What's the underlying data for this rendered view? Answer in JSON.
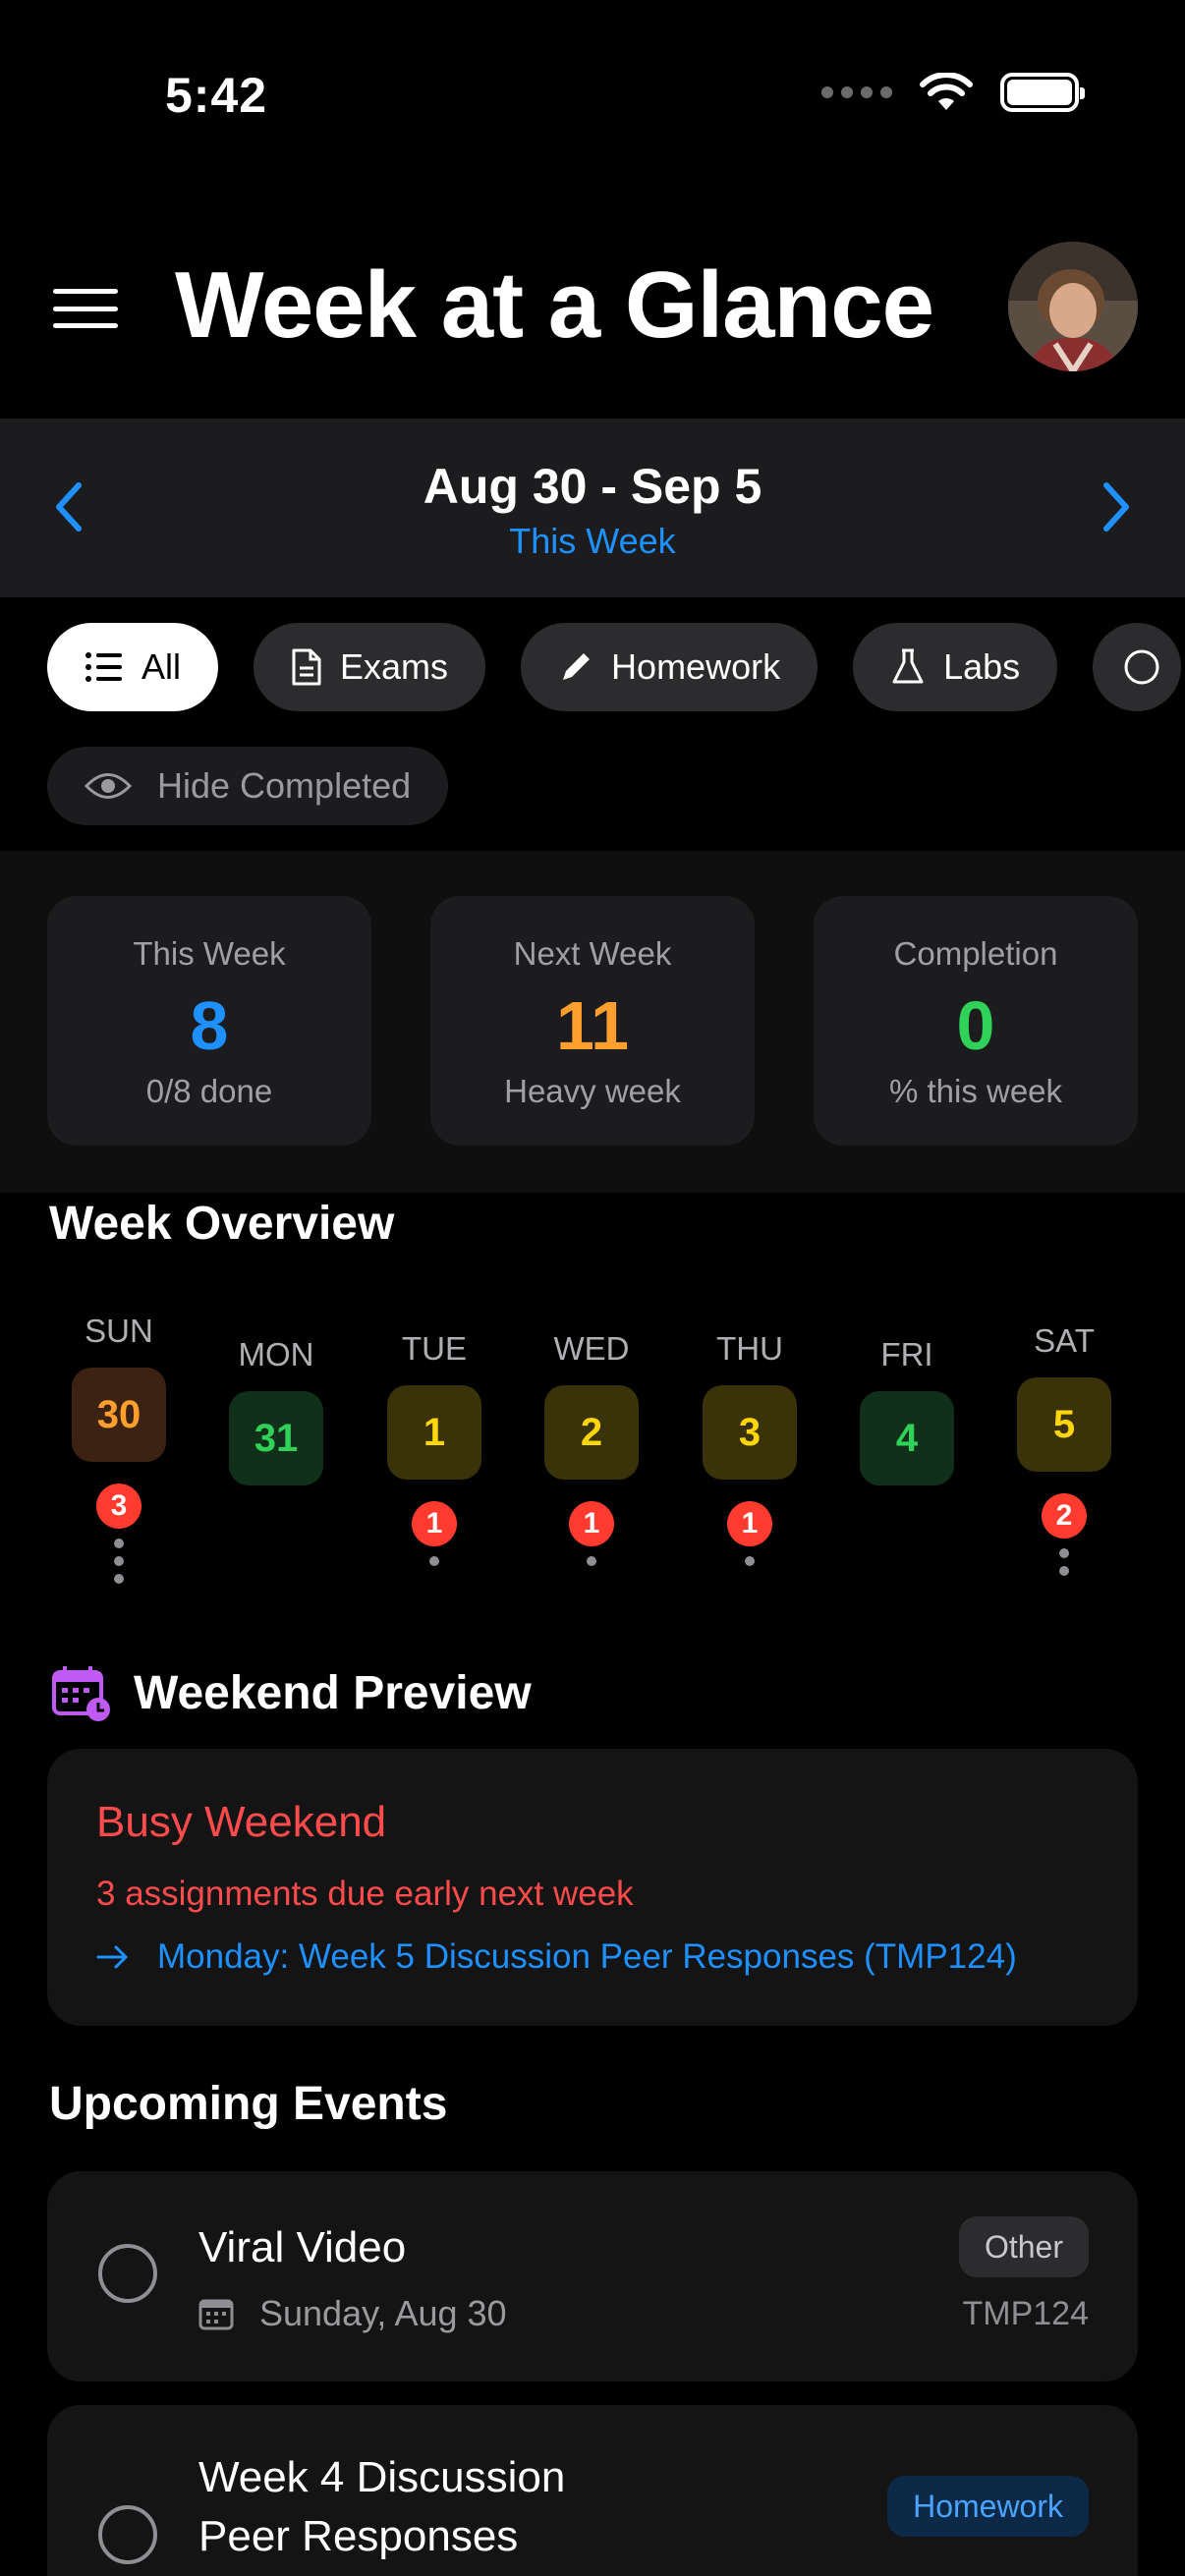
{
  "status_bar": {
    "time": "5:42"
  },
  "header": {
    "title": "Week at a Glance"
  },
  "week_nav": {
    "range": "Aug 30 - Sep 5",
    "sub": "This Week"
  },
  "filters": {
    "chips": [
      {
        "label": "All",
        "icon": "list-icon",
        "active": true
      },
      {
        "label": "Exams",
        "icon": "document-icon"
      },
      {
        "label": "Homework",
        "icon": "pencil-icon"
      },
      {
        "label": "Labs",
        "icon": "flask-icon"
      }
    ],
    "hide_completed": "Hide Completed"
  },
  "stats": [
    {
      "label": "This Week",
      "value": "8",
      "sub": "0/8 done",
      "color": "#1e90ff"
    },
    {
      "label": "Next Week",
      "value": "11",
      "sub": "Heavy week",
      "color": "#ff9f2e"
    },
    {
      "label": "Completion",
      "value": "0",
      "sub": "% this week",
      "color": "#30d158"
    }
  ],
  "overview": {
    "title": "Week Overview",
    "days": [
      {
        "name": "SUN",
        "date": "30",
        "badge": "3",
        "dots": 3
      },
      {
        "name": "MON",
        "date": "31"
      },
      {
        "name": "TUE",
        "date": "1",
        "badge": "1",
        "dots": 1
      },
      {
        "name": "WED",
        "date": "2",
        "badge": "1",
        "dots": 1
      },
      {
        "name": "THU",
        "date": "3",
        "badge": "1",
        "dots": 1
      },
      {
        "name": "FRI",
        "date": "4"
      },
      {
        "name": "SAT",
        "date": "5",
        "badge": "2",
        "dots": 2
      }
    ]
  },
  "weekend": {
    "title": "Weekend Preview",
    "card_title": "Busy Weekend",
    "card_sub": "3 assignments due early next week",
    "link": "Monday: Week 5 Discussion Peer Responses (TMP124)"
  },
  "events": {
    "title": "Upcoming Events",
    "items": [
      {
        "title": "Viral Video",
        "date": "Sunday, Aug 30",
        "tag": "Other",
        "course": "TMP124"
      },
      {
        "title_line1": "Week 4 Discussion",
        "title_line2": "Peer Responses",
        "tag": "Homework"
      }
    ]
  }
}
